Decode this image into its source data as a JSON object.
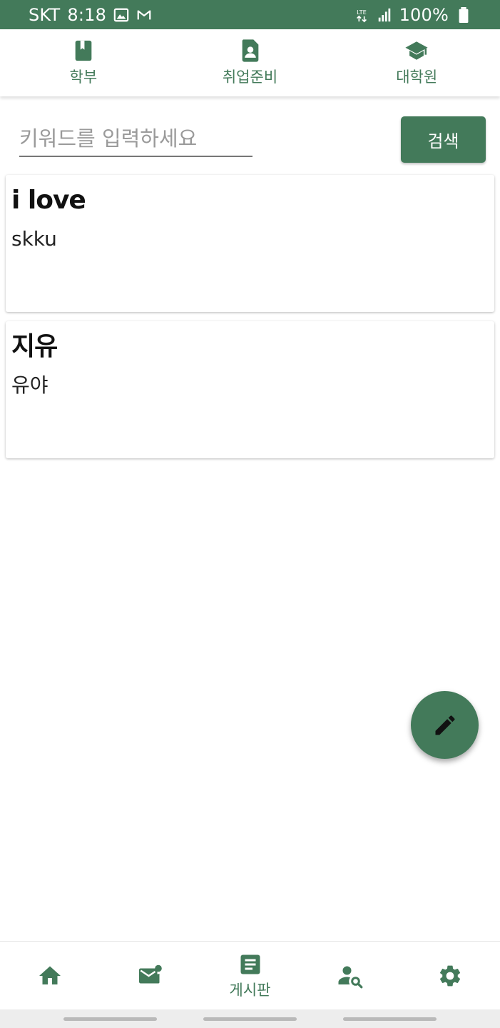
{
  "status_bar": {
    "carrier": "SKT",
    "time": "8:18",
    "network": "LTE",
    "battery": "100%",
    "icons": [
      "image-icon",
      "gmail-icon",
      "lte-icon",
      "signal-icon",
      "battery-icon"
    ]
  },
  "top_tabs": [
    {
      "label": "학부",
      "icon": "book-icon"
    },
    {
      "label": "취업준비",
      "icon": "id-badge-icon"
    },
    {
      "label": "대학원",
      "icon": "graduation-cap-icon"
    }
  ],
  "search": {
    "placeholder": "키워드를 입력하세요",
    "value": "",
    "button_label": "검색"
  },
  "posts": [
    {
      "title": "i love",
      "body": "skku"
    },
    {
      "title": "지유",
      "body": "유야"
    }
  ],
  "fab": {
    "icon": "pencil-icon"
  },
  "bottom_nav": [
    {
      "icon": "home-icon",
      "label": ""
    },
    {
      "icon": "mail-notification-icon",
      "label": ""
    },
    {
      "icon": "board-icon",
      "label": "게시판"
    },
    {
      "icon": "user-search-icon",
      "label": ""
    },
    {
      "icon": "gear-icon",
      "label": ""
    }
  ],
  "colors": {
    "primary": "#437a5a",
    "background": "#ffffff",
    "system_bar": "#ededed"
  }
}
